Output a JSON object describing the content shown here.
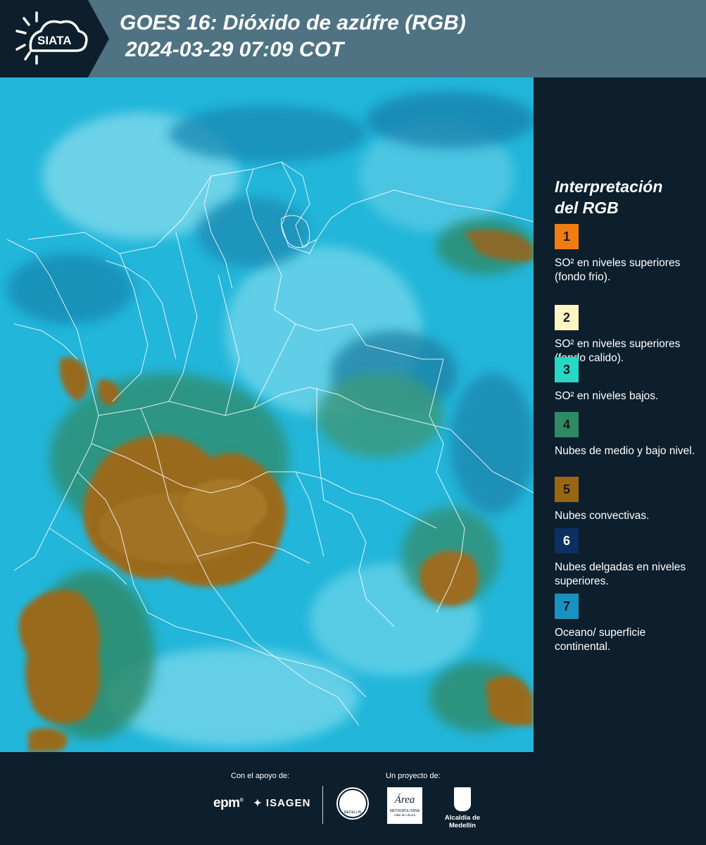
{
  "header": {
    "logo_text": "SIATA",
    "title_line1": "GOES 16: Dióxido de azúfre (RGB)",
    "title_line2": "2024-03-29 07:09 COT"
  },
  "legend": {
    "title": "Interpretación del RGB",
    "items": [
      {
        "number": "1",
        "color": "#f07d12",
        "label": "SO² en niveles superiores (fondo frio)."
      },
      {
        "number": "2",
        "color": "#fdf6c2",
        "label": "SO² en niveles superiores (fondo calido)."
      },
      {
        "number": "3",
        "color": "#27d8c5",
        "label": "SO² en niveles bajos."
      },
      {
        "number": "4",
        "color": "#2f8a63",
        "label": "Nubes de medio y bajo nivel."
      },
      {
        "number": "5",
        "color": "#9b6612",
        "label": "Nubes convectivas."
      },
      {
        "number": "6",
        "color": "#0e2f63",
        "label": "Nubes delgadas en niveles superiores."
      },
      {
        "number": "7",
        "color": "#1992c1",
        "label": "Oceano/ superficie continental."
      }
    ]
  },
  "footer": {
    "support_label": "Con el apoyo de:",
    "project_label": "Un proyecto de:",
    "logo_epm": "epm",
    "logo_isagen": "ISAGEN",
    "logo_area_main": "Área",
    "logo_area_sub": "METROPOLITANA",
    "logo_area_sub2": "Valle de Aburrá",
    "logo_alcaldia": "Alcaldía de Medellín",
    "logo_medellin_seal": "MEDELLÍN"
  },
  "colors": {
    "header_bg": "#4f7382",
    "dark_bg": "#0d1f2d",
    "map_cyan": "#23b5d8",
    "map_brown": "#9b6a1c",
    "map_green": "#2e8a6a"
  }
}
